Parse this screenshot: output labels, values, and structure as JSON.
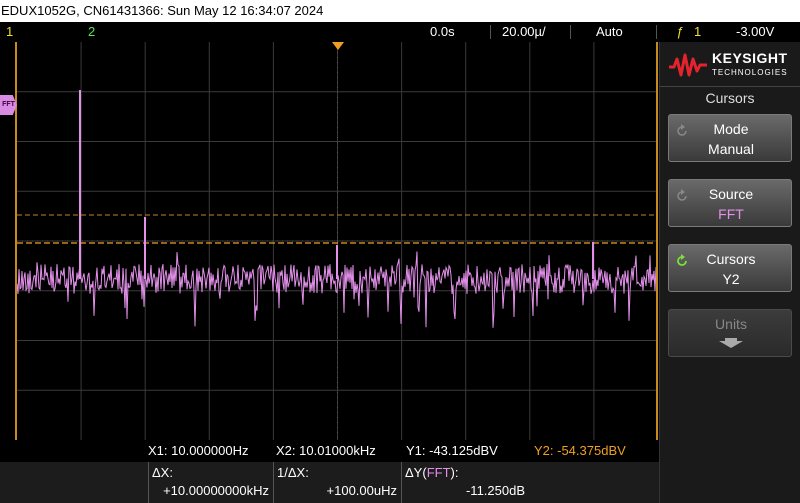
{
  "title_bar": {
    "text": "EDUX1052G, CN61431366: Sun May 12 16:34:07 2024"
  },
  "status": {
    "ch1": "1",
    "ch2": "2",
    "time_offset": "0.0s",
    "timebase": "20.00µ/",
    "trigger_mode": "Auto",
    "trigger_icon": "ƒ",
    "trigger_channel": "1",
    "trigger_level": "-3.00V"
  },
  "markers": {
    "fft_label": "FFT"
  },
  "panel": {
    "brand": "KEYSIGHT",
    "brand_sub": "TECHNOLOGIES",
    "menu_title": "Cursors",
    "softkeys": [
      {
        "label": "Mode",
        "value": "Manual"
      },
      {
        "label": "Source",
        "value": "FFT"
      },
      {
        "label": "Cursors",
        "value": "Y2"
      },
      {
        "label": "Units",
        "value": ""
      }
    ]
  },
  "readout": {
    "x1": "X1:  10.000000Hz",
    "x2": "X2:  10.01000kHz",
    "y1": "Y1: -43.125dBV",
    "y2": "Y2: -54.375dBV",
    "dx_label": "ΔX:",
    "dx_value": "+10.00000000kHz",
    "inv_dx_label": "1/ΔX:",
    "inv_dx_value": "+100.00uHz",
    "dy_label_prefix": "ΔY(",
    "dy_label_src": "FFT",
    "dy_label_suffix": "):",
    "dy_value": "-11.250dB"
  },
  "colors": {
    "trace": "#e390ea",
    "cursor": "#f0a020",
    "grid": "#3a3a3a",
    "ch1": "#f0e030",
    "ch2": "#5be35b"
  }
}
